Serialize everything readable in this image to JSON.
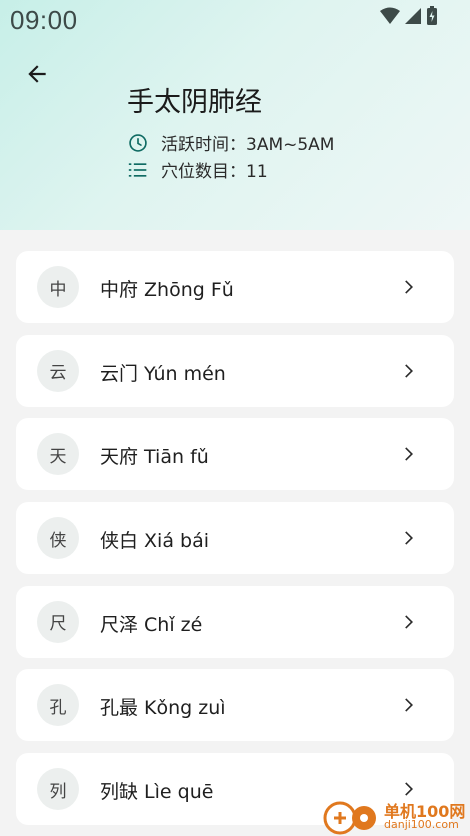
{
  "status_bar": {
    "time": "09:00",
    "icons": [
      "wifi-icon",
      "signal-icon",
      "battery-icon"
    ]
  },
  "header": {
    "title": "手太阴肺经",
    "active_time": "活跃时间：3AM~5AM",
    "point_count": "穴位数目：11"
  },
  "points": [
    {
      "badge": "中",
      "label": "中府 Zhōng Fǔ"
    },
    {
      "badge": "云",
      "label": "云门 Yún mén"
    },
    {
      "badge": "天",
      "label": "天府 Tiān fǔ"
    },
    {
      "badge": "侠",
      "label": "侠白 Xiá bái"
    },
    {
      "badge": "尺",
      "label": "尺泽 Chǐ zé"
    },
    {
      "badge": "孔",
      "label": "孔最 Kǒng zuì"
    },
    {
      "badge": "列",
      "label": "列缺 Lìe quē"
    }
  ],
  "watermark": {
    "name": "单机100网",
    "url": "danji100.com"
  },
  "colors": {
    "accent": "#0f6b63",
    "header_bg": "#d5f2ec",
    "card_bg": "#ffffff",
    "page_bg": "#f3f3f3"
  }
}
